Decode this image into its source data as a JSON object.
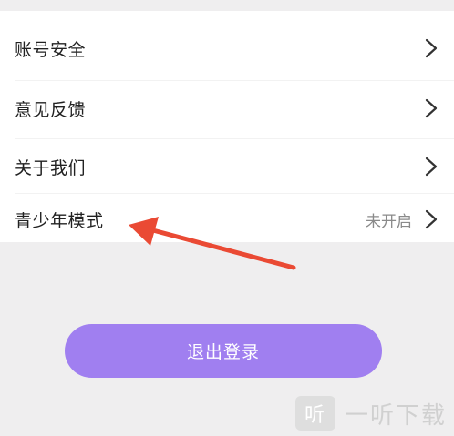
{
  "menu": {
    "items": [
      {
        "label": "账号安全",
        "status": ""
      },
      {
        "label": "意见反馈",
        "status": ""
      },
      {
        "label": "关于我们",
        "status": ""
      },
      {
        "label": "青少年模式",
        "status": "未开启"
      }
    ]
  },
  "logout_label": "退出登录",
  "watermark": {
    "logo_glyph": "听",
    "text": "一听下载"
  },
  "colors": {
    "accent": "#a07ff0",
    "arrow": "#ea4a34",
    "background": "#efeeef"
  },
  "icons": {
    "chevron": "chevron-right-icon",
    "arrow": "red-arrow-annotation"
  }
}
